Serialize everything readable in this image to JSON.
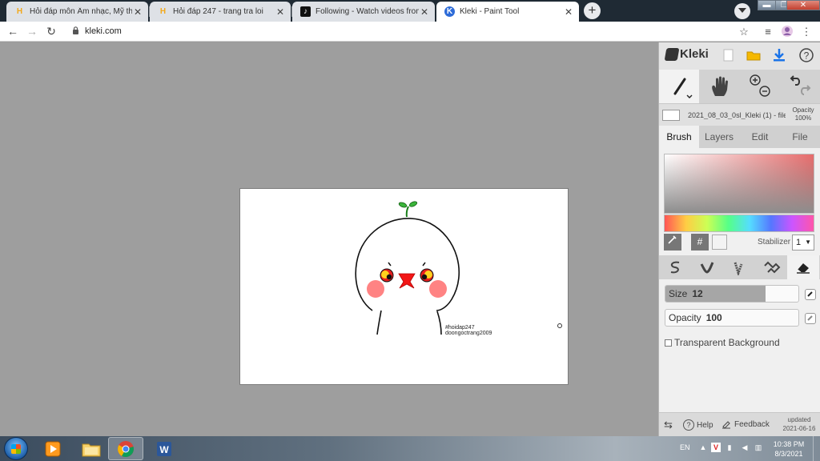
{
  "browser": {
    "tabs": [
      {
        "title": "Hỏi đáp môn Âm nhạc, Mỹ thuật",
        "icon": "hoidap-favicon-icon",
        "close": "✕",
        "active": false
      },
      {
        "title": "Hỏi đáp 247 - trang tra loi",
        "icon": "hoidap-favicon-icon",
        "close": "✕",
        "active": false
      },
      {
        "title": "Following - Watch videos from c",
        "icon": "tiktok-favicon-icon",
        "close": "✕",
        "active": false
      },
      {
        "title": "Kleki - Paint Tool",
        "icon": "kleki-favicon-icon",
        "close": "✕",
        "active": true
      }
    ],
    "new_tab": "+",
    "window_controls": {
      "minimize": "▬",
      "maximize": "❐",
      "close": "✕"
    },
    "address": "kleki.com",
    "nav": {
      "back": "←",
      "forward": "→",
      "reload": "↻"
    }
  },
  "canvas": {
    "watermark_line1": "#hoidap247",
    "watermark_line2": "doongoctrang2009"
  },
  "kleki": {
    "logo": "Kleki",
    "tools": [
      "brush-tool",
      "hand-tool",
      "zoom-tool",
      "undo-redo"
    ],
    "file_name": "2021_08_03_0sl_Kleki (1) - file",
    "opacity_label": "Opacity",
    "opacity_value": "100%",
    "tabs": [
      {
        "label": "Brush",
        "active": true
      },
      {
        "label": "Layers",
        "active": false
      },
      {
        "label": "Edit",
        "active": false
      },
      {
        "label": "File",
        "active": false
      }
    ],
    "color_hex_label": "#",
    "stabilizer_label": "Stabilizer",
    "stabilizer_value": "1",
    "brush": {
      "size_label": "Size",
      "size_value": "12",
      "size_fill": 0.75,
      "opacity_label": "Opacity",
      "opacity_value": "100",
      "transparent_bg_label": "Transparent Background"
    },
    "footer": {
      "help": "Help",
      "feedback": "Feedback",
      "updated_label": "updated",
      "updated_date": "2021-06-16"
    }
  },
  "taskbar": {
    "apps": [
      "media-player-icon",
      "file-explorer-icon",
      "chrome-icon",
      "word-icon"
    ],
    "lang": "EN",
    "time": "10:38 PM",
    "date": "8/3/2021"
  }
}
